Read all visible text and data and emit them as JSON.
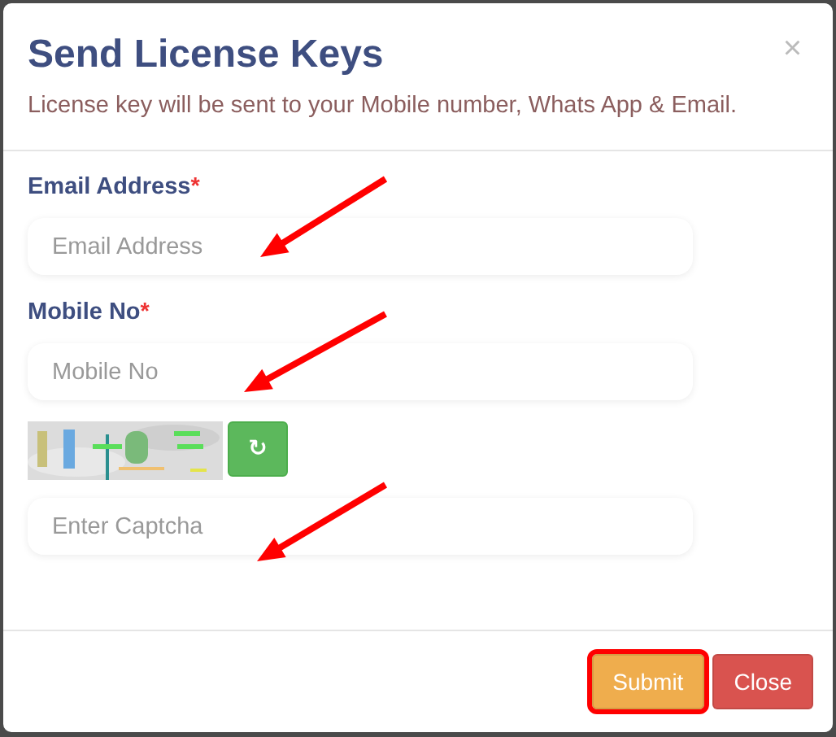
{
  "dialog": {
    "title": "Send License Keys",
    "subtitle": "License key will be sent to your Mobile number, Whats App & Email.",
    "close": "×"
  },
  "fields": [
    {
      "kind": "text",
      "label": "Email Address",
      "required_mark": "*",
      "placeholder": "Email Address"
    },
    {
      "kind": "text",
      "label": "Mobile No",
      "required_mark": "*",
      "placeholder": "Mobile No"
    },
    {
      "kind": "captcha",
      "refresh": "↻",
      "placeholder": "Enter Captcha"
    }
  ],
  "buttons": [
    {
      "label": "Submit",
      "kind": "warning",
      "highlighted": true
    },
    {
      "label": "Close",
      "kind": "danger",
      "highlighted": false
    }
  ]
}
